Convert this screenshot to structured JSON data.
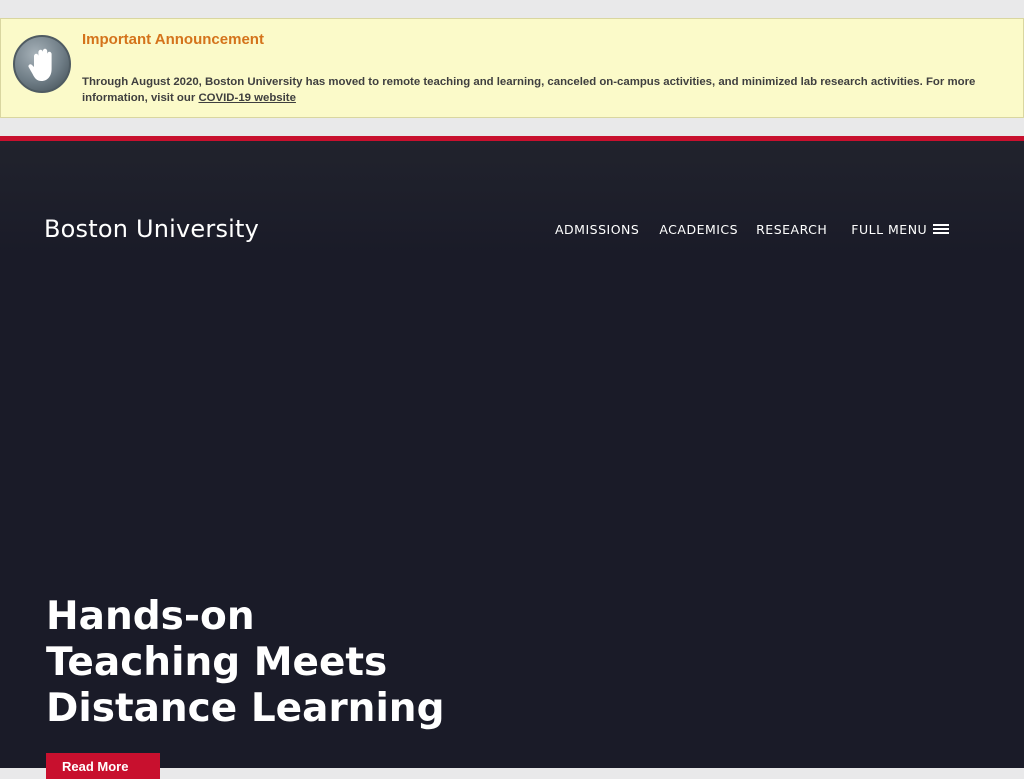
{
  "announcement": {
    "title": "Important Announcement",
    "body_before": "Through August 2020, Boston University has moved to remote teaching and learning, canceled on-campus activities, and minimized lab research activities. For more information, visit our ",
    "link_label": "COVID-19 website",
    "body_after": "",
    "icon": "stop-hand-icon"
  },
  "header": {
    "logo": "Boston University",
    "nav": {
      "admissions": "ADMISSIONS",
      "academics": "ACADEMICS",
      "research": "RESEARCH",
      "full_menu": "FULL MENU"
    },
    "menu_icon": "hamburger-icon"
  },
  "hero": {
    "headline": "Hands-on Teaching Meets Distance Learning",
    "cta_label": "Read More"
  },
  "colors": {
    "banner_bg": "#fbfac9",
    "announcement_title": "#d4731b",
    "brand_red": "#c8102e",
    "hero_bg": "#1a1b28"
  }
}
